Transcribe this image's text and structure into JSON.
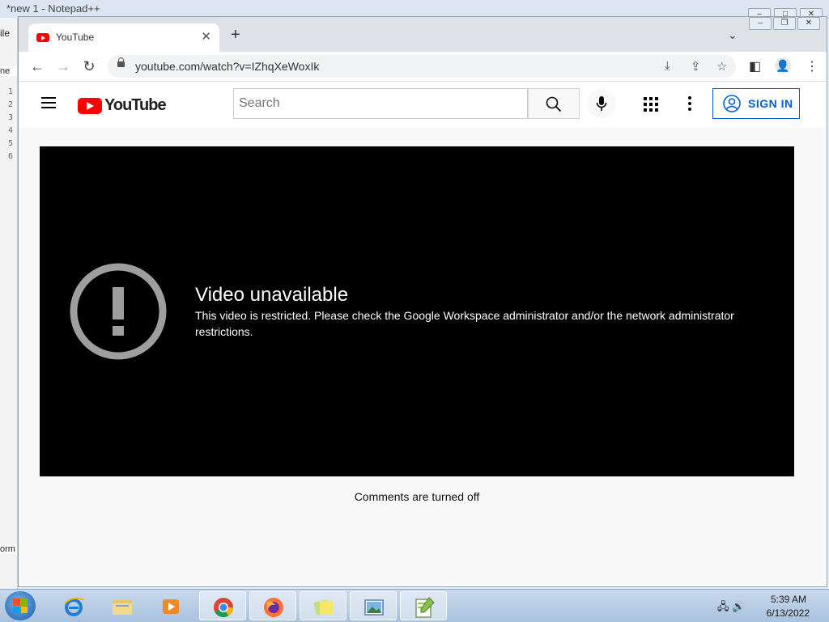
{
  "notepad": {
    "title": "*new 1 - Notepad++",
    "menu_fragment": "ile",
    "tab_fragment": "ne",
    "line_numbers": [
      "1",
      "2",
      "3",
      "4",
      "5",
      "6"
    ],
    "status_fragment": "orm"
  },
  "browser": {
    "tab_title": "YouTube",
    "url": "youtube.com/watch?v=IZhqXeWoxIk"
  },
  "youtube": {
    "logo_text": "YouTube",
    "search_placeholder": "Search",
    "sign_in": "SIGN IN",
    "error_title": "Video unavailable",
    "error_message": "This video is restricted. Please check the Google Workspace administrator and/or the network administrator restrictions.",
    "comments_status": "Comments are turned off"
  },
  "taskbar": {
    "time": "5:39 AM",
    "date": "6/13/2022",
    "apps": [
      "internet-explorer",
      "file-explorer",
      "media-player",
      "chrome",
      "firefox",
      "sticky-notes",
      "photo-viewer",
      "notepad-plus-plus"
    ]
  },
  "colors": {
    "youtube_red": "#ff0000",
    "sign_in_blue": "#065fd4",
    "player_bg": "#000000"
  }
}
